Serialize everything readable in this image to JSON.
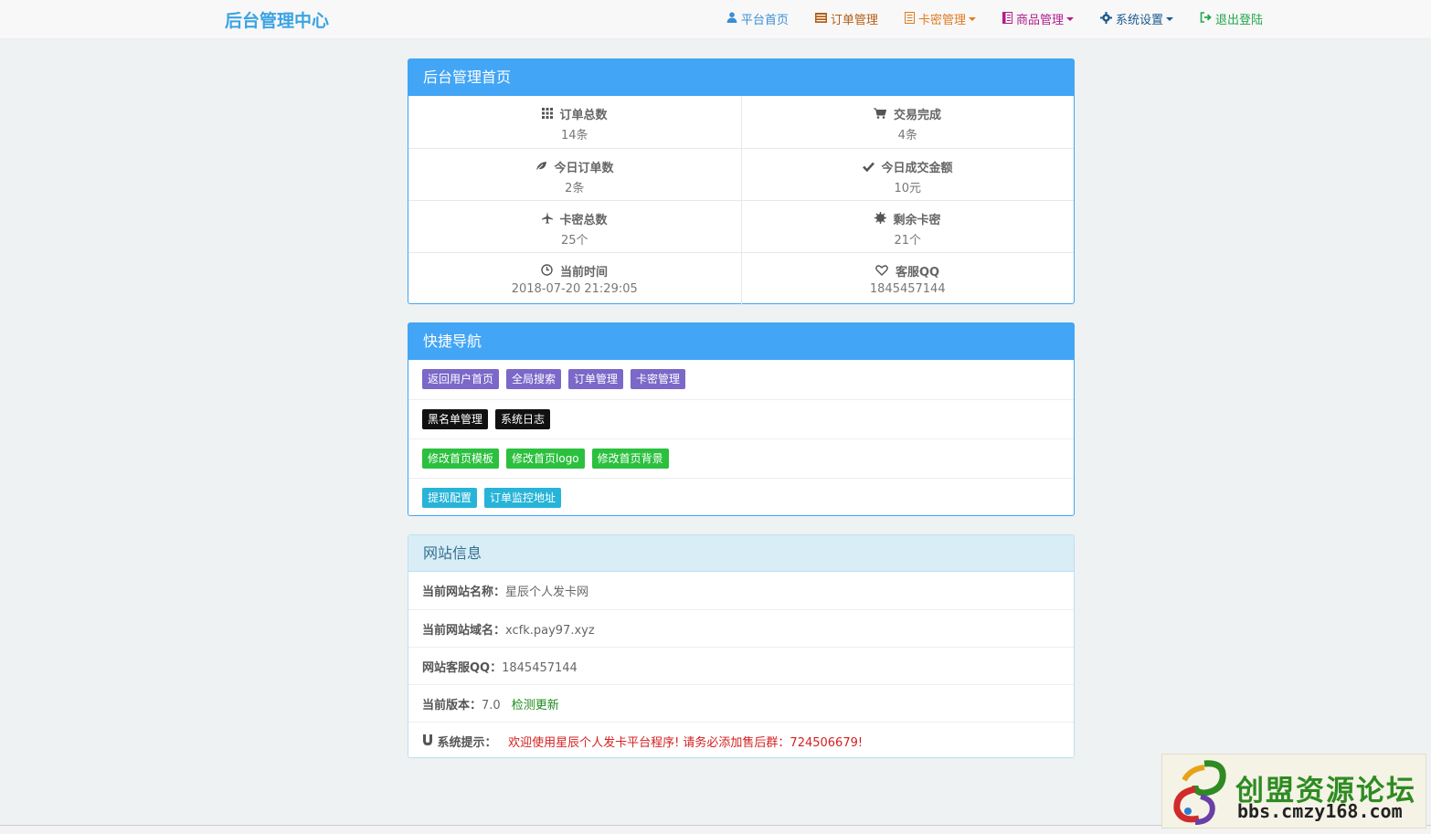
{
  "navbar": {
    "brand": "后台管理中心",
    "items": [
      {
        "label": "平台首页",
        "icon": "user-icon",
        "color": "#3a8ed6",
        "dropdown": false
      },
      {
        "label": "订单管理",
        "icon": "list-icon",
        "color": "#b45d12",
        "dropdown": false
      },
      {
        "label": "卡密管理",
        "icon": "card-icon",
        "color": "#e07a20",
        "dropdown": true
      },
      {
        "label": "商品管理",
        "icon": "goods-icon",
        "color": "#b01e8c",
        "dropdown": true
      },
      {
        "label": "系统设置",
        "icon": "gear-icon",
        "color": "#1d5a8e",
        "dropdown": true
      },
      {
        "label": "退出登陆",
        "icon": "logout-icon",
        "color": "#22a64a",
        "dropdown": false
      }
    ]
  },
  "dashboard": {
    "title": "后台管理首页",
    "stats": [
      {
        "label": "订单总数",
        "value": "14条",
        "icon": "grid-icon"
      },
      {
        "label": "交易完成",
        "value": "4条",
        "icon": "cart-icon"
      },
      {
        "label": "今日订单数",
        "value": "2条",
        "icon": "leaf-icon"
      },
      {
        "label": "今日成交金额",
        "value": "10元",
        "icon": "check-icon"
      },
      {
        "label": "卡密总数",
        "value": "25个",
        "icon": "plane-icon"
      },
      {
        "label": "剩余卡密",
        "value": "21个",
        "icon": "certificate-icon"
      },
      {
        "label": "当前时间",
        "value": "2018-07-20 21:29:05",
        "icon": "clock-icon"
      },
      {
        "label": "客服QQ",
        "value": "1845457144",
        "icon": "heart-icon"
      }
    ]
  },
  "quicknav": {
    "title": "快捷导航",
    "rows": [
      {
        "style": "purple",
        "items": [
          "返回用户首页",
          "全局搜索",
          "订单管理",
          "卡密管理"
        ]
      },
      {
        "style": "black",
        "items": [
          "黑名单管理",
          "系统日志"
        ]
      },
      {
        "style": "green",
        "items": [
          "修改首页模板",
          "修改首页logo",
          "修改首页背景"
        ]
      },
      {
        "style": "cyan",
        "items": [
          "提现配置",
          "订单监控地址"
        ]
      }
    ]
  },
  "siteinfo": {
    "title": "网站信息",
    "name_key": "当前网站名称：",
    "name_val": "星辰个人发卡网",
    "domain_key": "当前网站域名：",
    "domain_val": "xcfk.pay97.xyz",
    "qq_key": "网站客服QQ：",
    "qq_val": "1845457144",
    "version_key": "当前版本：",
    "version_val": "7.0",
    "update_link": "检测更新",
    "tip_key": "系统提示：",
    "tip_val": "欢迎使用星辰个人发卡平台程序! 请务必添加售后群：724506679!"
  },
  "watermark": {
    "title": "创盟资源论坛",
    "url": "bbs.cmzy168.com"
  }
}
